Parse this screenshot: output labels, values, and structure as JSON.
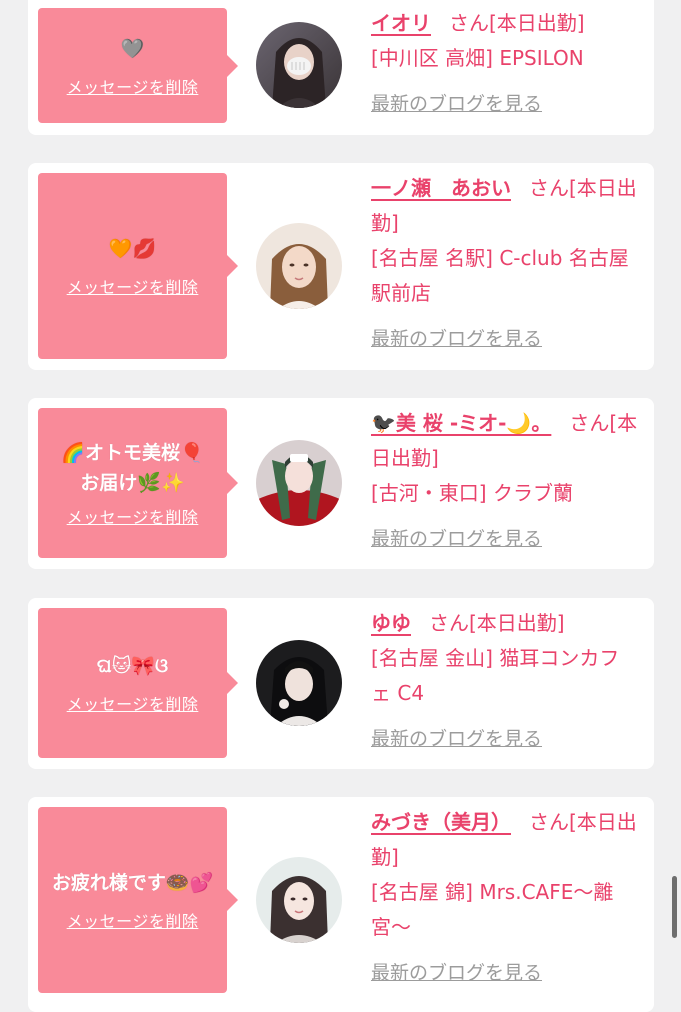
{
  "cards": [
    {
      "message": "🩶",
      "delete_label": "メッセージを削除",
      "name": "イオリ",
      "san": "さん",
      "status": "[本日出勤]",
      "shop": "[中川区 高畑] EPSILON",
      "blog_link": "最新のブログを見る"
    },
    {
      "message": "🧡💋",
      "delete_label": "メッセージを削除",
      "name": "一ノ瀬　あおい",
      "san": "さん",
      "status": "[本日出勤]",
      "shop": "[名古屋 名駅] C-club 名古屋駅前店",
      "blog_link": "最新のブログを見る"
    },
    {
      "message": "🌈オトモ美桜🎈お届け🌿✨",
      "delete_label": "メッセージを削除",
      "name": "🐦‍⬛美 桜 -ミオ-🌙。",
      "san": "さん",
      "status": "[本日出勤]",
      "shop": "[古河・東口] クラブ蘭",
      "blog_link": "最新のブログを見る"
    },
    {
      "message": "ଘ🐱🎀ଓ",
      "delete_label": "メッセージを削除",
      "name": "ゆゆ",
      "san": "さん",
      "status": "[本日出勤]",
      "shop": "[名古屋 金山] 猫耳コンカフェ C4",
      "blog_link": "最新のブログを見る"
    },
    {
      "message": "お疲れ様です🍩💕",
      "delete_label": "メッセージを削除",
      "name": "みづき（美月）",
      "san": "さん",
      "status": "[本日出勤]",
      "shop": "[名古屋 錦] Mrs.CAFE〜離宮〜",
      "blog_link": "最新のブログを見る"
    }
  ],
  "colors": {
    "bubble": "#f98a99",
    "accent": "#e9426b",
    "link_gray": "#9c9c9c",
    "background": "#f0f0f1"
  }
}
